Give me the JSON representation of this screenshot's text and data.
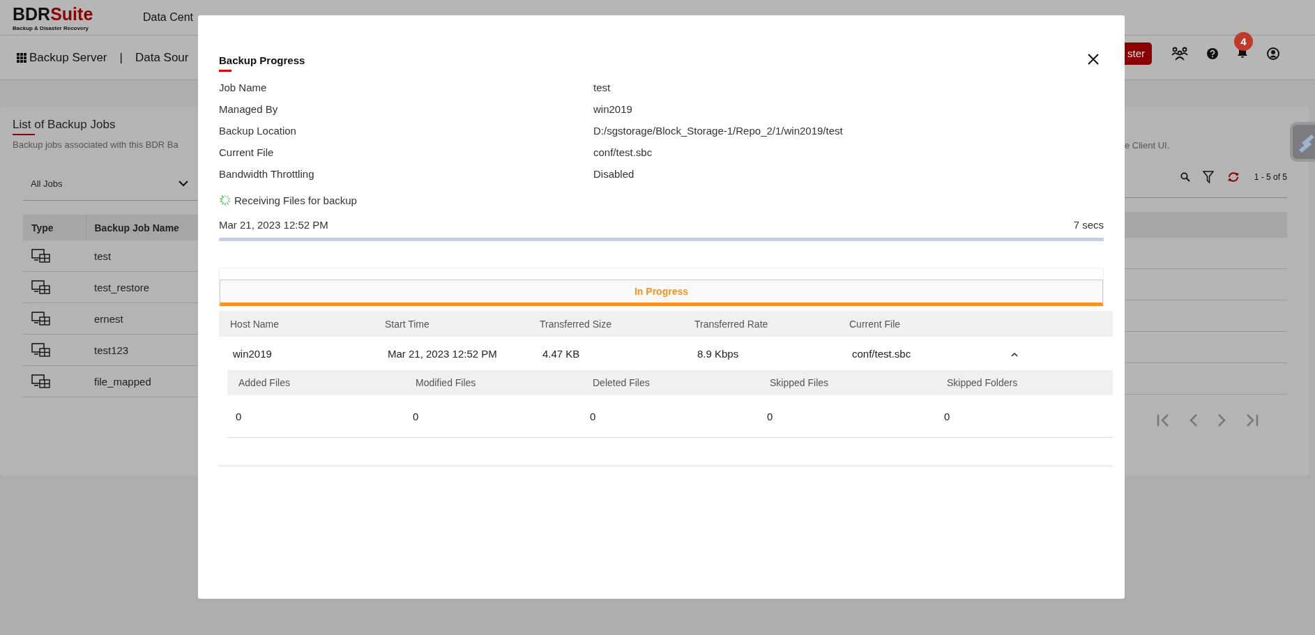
{
  "header": {
    "brand": "BDR",
    "brand_accent": "Suite",
    "tagline": "Backup & Disaster Recovery",
    "nav_text": "Data Cent"
  },
  "toolbar": {
    "title": "Backup Server",
    "separator": "|",
    "nav_text": "Data Sour",
    "button": "ster",
    "notification_count": "4"
  },
  "jobs_panel": {
    "title": "List of Backup Jobs",
    "description": "Backup jobs associated with this BDR Ba",
    "description_tail": "e Client UI.",
    "filter": "All Jobs",
    "range": "1 - 5 of 5",
    "columns": [
      "Type",
      "Backup Job Name"
    ],
    "rows": [
      {
        "name": "test"
      },
      {
        "name": "test_restore"
      },
      {
        "name": "ernest"
      },
      {
        "name": "test123"
      },
      {
        "name": "file_mapped"
      }
    ]
  },
  "modal": {
    "title": "Backup Progress",
    "details": [
      {
        "label": "Job Name",
        "value": "test"
      },
      {
        "label": "Managed By",
        "value": "win2019"
      },
      {
        "label": "Backup Location",
        "value": "D:/sgstorage/Block_Storage-1/Repo_2/1/win2019/test"
      },
      {
        "label": "Current File",
        "value": "conf/test.sbc"
      },
      {
        "label": "Bandwidth Throttling",
        "value": "Disabled"
      }
    ],
    "status": "Receiving Files for backup",
    "started": "Mar 21, 2023 12:52 PM",
    "elapsed": "7 secs",
    "level": 1,
    "tabs": [
      {
        "label": "In Progress",
        "selected": true
      }
    ],
    "table": {
      "columns": [
        "Host Name",
        "Start Time",
        "Transferred Size",
        "Transferred Rate",
        "Current File"
      ],
      "rows": [
        {
          "cells": [
            "win2019",
            "Mar 21, 2023 12:52 PM",
            "4.47 KB",
            "8.9 Kbps",
            "conf/test.sbc"
          ],
          "expanded": true,
          "details": {
            "columns": [
              "Added Files",
              "Modified Files",
              "Deleted Files",
              "Skipped Files",
              "Skipped Folders"
            ],
            "values": [
              "0",
              "0",
              "0",
              "0",
              "0"
            ]
          }
        }
      ]
    }
  }
}
